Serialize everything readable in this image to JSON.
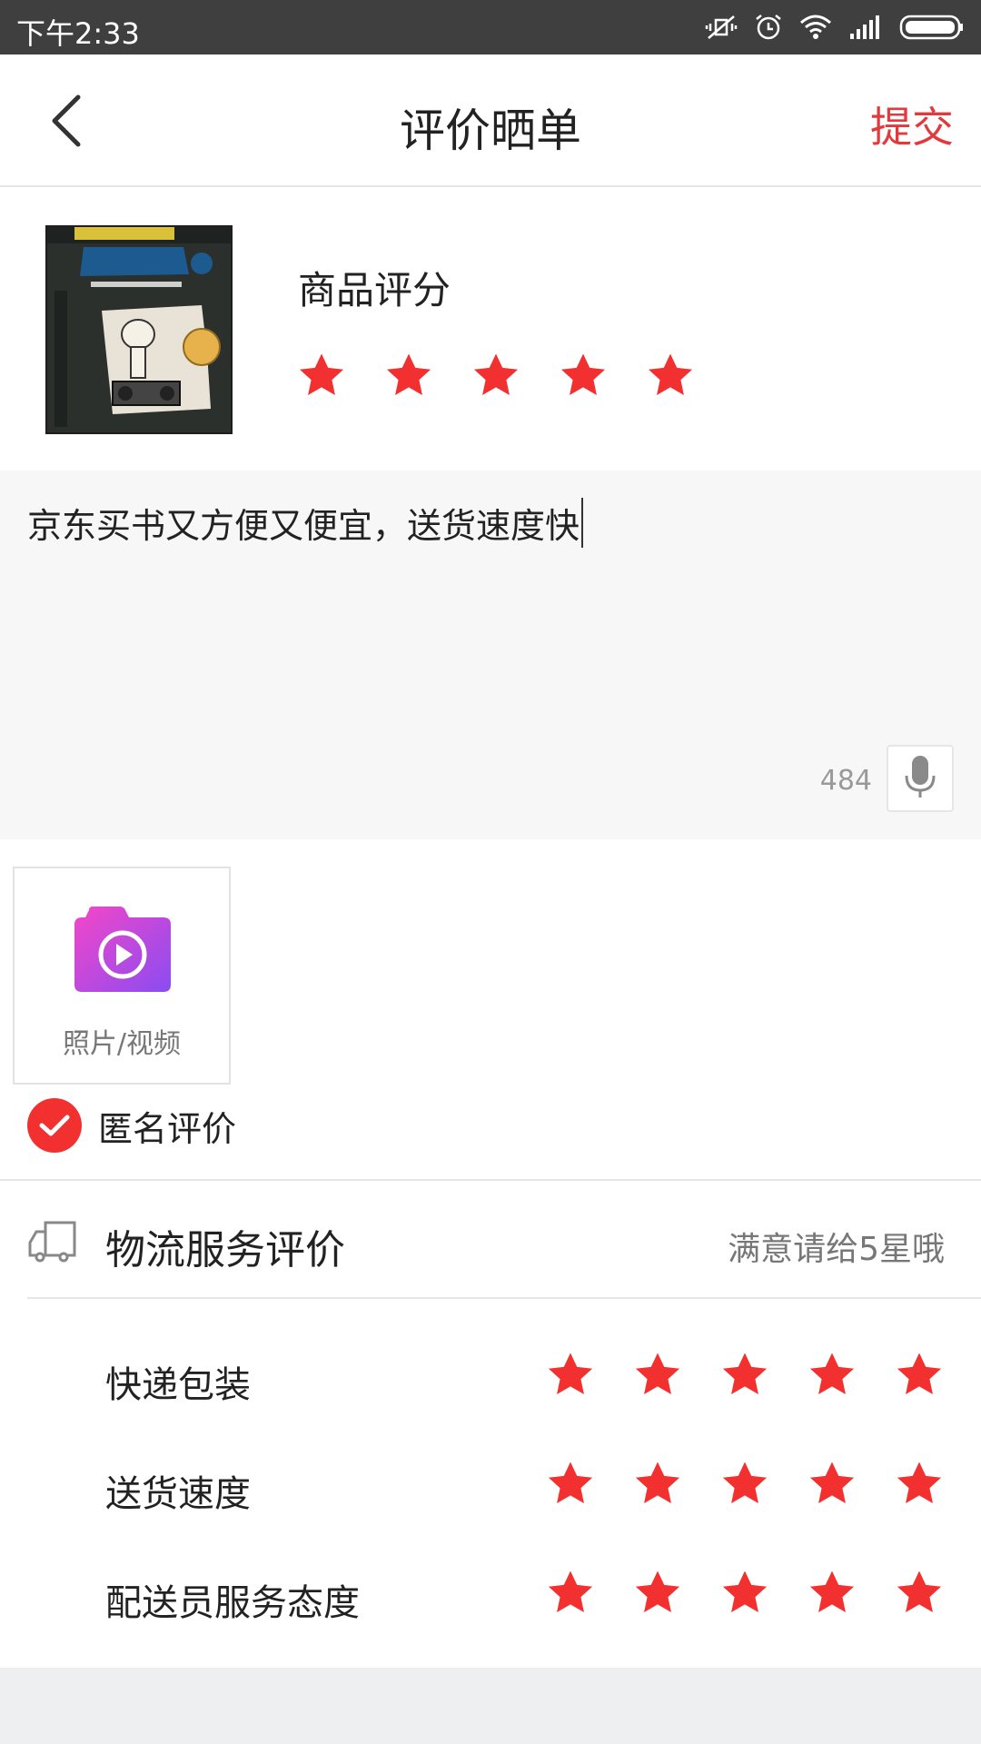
{
  "status_bar": {
    "time": "下午2:33",
    "icons": [
      "mute-vibrate-icon",
      "alarm-icon",
      "wifi-icon",
      "signal-icon",
      "battery-icon"
    ]
  },
  "nav": {
    "back_icon": "chevron-left-icon",
    "title": "评价晒单",
    "submit_label": "提交",
    "accent_color": "#e4393c"
  },
  "product": {
    "rating_title": "商品评分",
    "rating": 5,
    "max_rating": 5
  },
  "review": {
    "text": "京东买书又方便又便宜，送货速度快",
    "remaining_chars": "484",
    "mic_icon": "microphone-icon"
  },
  "media": {
    "upload_label": "照片/视频",
    "icon": "camera-video-icon"
  },
  "anonymous": {
    "label": "匿名评价",
    "checked": true
  },
  "logistics": {
    "icon": "truck-icon",
    "title": "物流服务评价",
    "hint": "满意请给5星哦",
    "items": [
      {
        "label": "快递包装",
        "rating": 5
      },
      {
        "label": "送货速度",
        "rating": 5
      },
      {
        "label": "配送员服务态度",
        "rating": 5
      }
    ]
  },
  "colors": {
    "star": "#f23030",
    "status_bar_bg": "#3f3f3f",
    "review_bg": "#f7f7f7"
  }
}
